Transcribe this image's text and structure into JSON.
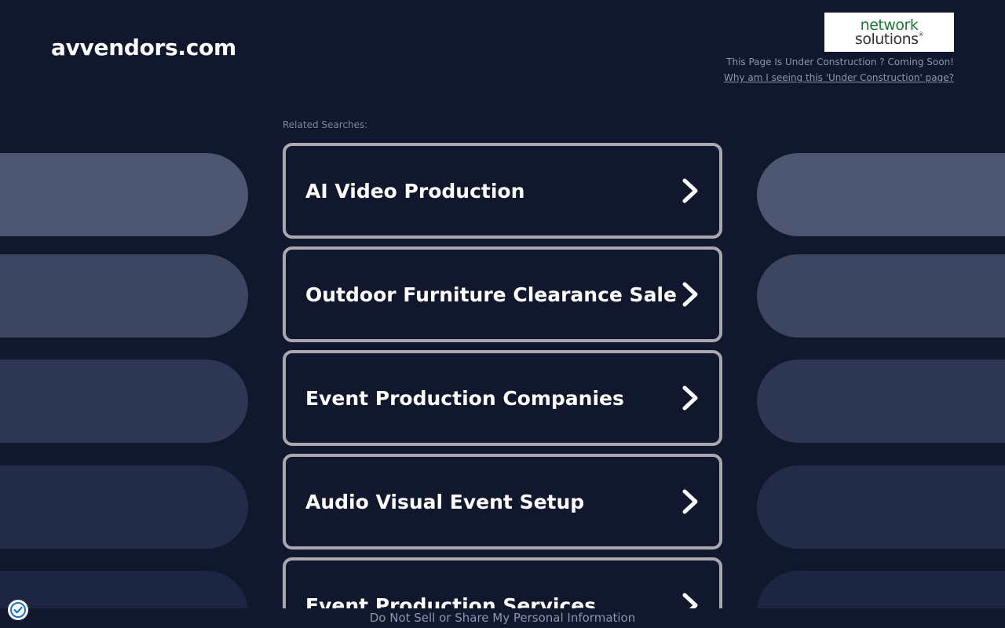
{
  "header": {
    "domain": "avvendors.com",
    "logo": {
      "line1": "network",
      "line2": "solutions",
      "mark": "®"
    },
    "under_construction": "This Page Is Under Construction ? Coming Soon!",
    "why_link": "Why am I seeing this 'Under Construction' page?"
  },
  "related": {
    "label": "Related Searches:",
    "items": [
      {
        "label": "AI Video Production",
        "icon": "chevron-right-icon"
      },
      {
        "label": "Outdoor Furniture Clearance Sale",
        "icon": "chevron-right-icon"
      },
      {
        "label": "Event Production Companies",
        "icon": "chevron-right-icon"
      },
      {
        "label": "Audio Visual Event Setup",
        "icon": "chevron-right-icon"
      },
      {
        "label": "Event Production Services",
        "icon": "chevron-right-icon"
      }
    ]
  },
  "footer": {
    "privacy_link": "Do Not Sell or Share My Personal Information"
  },
  "colors": {
    "background": "#11172c",
    "box_border": "#a8a8ad",
    "logo_green": "#1d7a34",
    "muted_text": "#8d94b0"
  }
}
